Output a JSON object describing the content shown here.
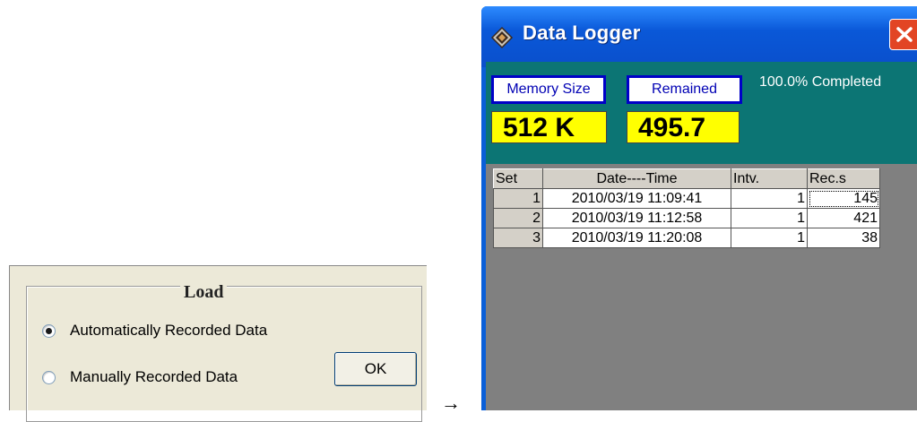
{
  "load_dialog": {
    "title": "Load",
    "options": [
      {
        "label": "Automatically Recorded Data",
        "selected": true
      },
      {
        "label": "Manually Recorded Data",
        "selected": false
      }
    ],
    "ok_label": "OK"
  },
  "arrow": "→",
  "data_logger": {
    "title": "Data Logger",
    "memory_size_label": "Memory Size",
    "memory_size_value": "512 K",
    "remained_label": "Remained",
    "remained_value": "495.7",
    "status": "100.0% Completed",
    "table": {
      "headers": [
        "Set",
        "Date----Time",
        "Intv.",
        "Rec.s"
      ],
      "rows": [
        [
          "1",
          "2010/03/19 11:09:41",
          "1",
          "145"
        ],
        [
          "2",
          "2010/03/19 11:12:58",
          "1",
          "421"
        ],
        [
          "3",
          "2010/03/19 11:20:08",
          "1",
          "38"
        ]
      ]
    }
  },
  "colors": {
    "titlebar": "#0a58d8",
    "info_bg": "#0c7574",
    "value_bg": "#ffff00",
    "grid_bg": "#808080",
    "close_button": "#e24524"
  }
}
